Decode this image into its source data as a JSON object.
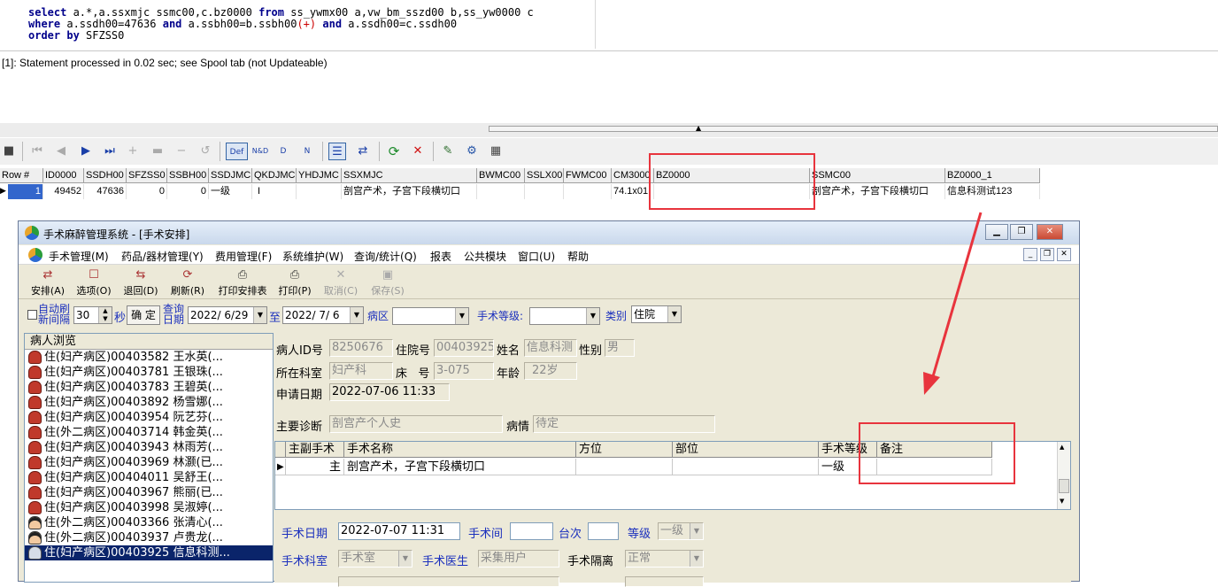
{
  "sql": {
    "line1": {
      "k1": "select",
      "t1": " a.*,a.ssxmjc ssmc00,c.bz0000 ",
      "k2": "from",
      "t2": " ss_ywmx00 a,vw_bm_sszd00 b,ss_yw0000 c"
    },
    "line2": {
      "k1": "where",
      "t1": " a.ssdh00=47636 ",
      "k2": "and",
      "t2": " a.ssbh00=b.ssbh00",
      "pl": "(+)",
      "k3": "and",
      "t3": " a.ssdh00=c.ssdh00"
    },
    "line3": {
      "k1": "order by",
      "t1": " SFZSS0"
    }
  },
  "status_message": "[1]: Statement processed in 0.02 sec; see Spool tab (not Updateable)",
  "toolbar": {
    "def_label": "Def",
    "nd_label": "N&D",
    "d_label": "D",
    "n_label": "N"
  },
  "result_grid": {
    "headers": [
      "Row #",
      "ID0000",
      "SSDH00",
      "SFZSS0",
      "SSBH00",
      "SSDJMC",
      "QKDJMC",
      "YHDJMC",
      "SSXMJC",
      "BWMC00",
      "SSLX00",
      "FWMC00",
      "CM3000",
      "BZ0000",
      "SSMC00",
      "BZ0000_1"
    ],
    "row": [
      "1",
      "49452",
      "47636",
      "0",
      "0",
      "一级",
      "I",
      "",
      "剖宫产术，子宫下段横切口",
      "",
      "",
      "",
      "74.1x01",
      "",
      "剖宫产术，子宫下段横切口",
      "信息科测试123"
    ]
  },
  "app": {
    "title": "手术麻醉管理系统 - [手术安排]",
    "menus": [
      "手术管理(M)",
      "药品/器材管理(Y)",
      "费用管理(F)",
      "系统维护(W)",
      "查询/统计(Q)",
      "报表",
      "公共模块",
      "窗口(U)",
      "帮助"
    ],
    "toolbar": [
      {
        "label": "安排(A)",
        "icon": "arrange-icon",
        "enabled": true
      },
      {
        "label": "选项(O)",
        "icon": "options-icon",
        "enabled": true
      },
      {
        "label": "退回(D)",
        "icon": "return-icon",
        "enabled": true
      },
      {
        "label": "刷新(R)",
        "icon": "refresh-icon",
        "enabled": true
      },
      {
        "label": "打印安排表",
        "icon": "print-schedule-icon",
        "enabled": true
      },
      {
        "label": "打印(P)",
        "icon": "print-icon",
        "enabled": true
      },
      {
        "label": "取消(C)",
        "icon": "cancel-icon",
        "enabled": false
      },
      {
        "label": "保存(S)",
        "icon": "save-icon",
        "enabled": false
      }
    ],
    "filter": {
      "auto_refresh_label_1": "自动刷",
      "auto_refresh_label_2": "新间隔",
      "interval_value": "30",
      "interval_unit": "秒",
      "confirm_label": "确 定",
      "query_label_1": "查询",
      "query_label_2": "日期",
      "date_from": "2022/ 6/29",
      "to_label": "至",
      "date_to": "2022/ 7/ 6",
      "ward_label": "病区",
      "ward_value": "",
      "level_label": "手术等级:",
      "level_value": "",
      "type_label": "类别",
      "type_value": "住院"
    },
    "patients": {
      "header": "病人浏览",
      "items": [
        {
          "text": "住(妇产病区)00403582 王水英(...",
          "icon": "f"
        },
        {
          "text": "住(妇产病区)00403781 王银珠(...",
          "icon": "f"
        },
        {
          "text": "住(妇产病区)00403783 王碧英(...",
          "icon": "f"
        },
        {
          "text": "住(妇产病区)00403892 杨雪娜(...",
          "icon": "f"
        },
        {
          "text": "住(妇产病区)00403954 阮艺芬(...",
          "icon": "f"
        },
        {
          "text": "住(外二病区)00403714 韩金英(...",
          "icon": "f"
        },
        {
          "text": "住(妇产病区)00403943 林雨芳(...",
          "icon": "f"
        },
        {
          "text": "住(妇产病区)00403969 林灏(已...",
          "icon": "f"
        },
        {
          "text": "住(妇产病区)00404011 吴舒王(...",
          "icon": "f"
        },
        {
          "text": "住(妇产病区)00403967 熊丽(已...",
          "icon": "f"
        },
        {
          "text": "住(妇产病区)00403998 吴淑婷(...",
          "icon": "f"
        },
        {
          "text": "住(外二病区)00403366 张清心(...",
          "icon": "m"
        },
        {
          "text": "住(外二病区)00403937 卢贵龙(...",
          "icon": "m"
        },
        {
          "text": "住(妇产病区)00403925 信息科测...",
          "icon": "s",
          "selected": true
        }
      ]
    },
    "detail": {
      "patient_id_label": "病人ID号",
      "patient_id": "8250676",
      "inpatient_no_label": "住院号",
      "inpatient_no": "00403925",
      "name_label": "姓名",
      "name": "信息科测",
      "gender_label": "性别",
      "gender": "男",
      "dept_label": "所在科室",
      "dept": "妇产科",
      "bed_label": "床   号",
      "bed": "3-075",
      "age_label": "年龄",
      "age": "22岁",
      "apply_date_label": "申请日期",
      "apply_date": "2022-07-06 11:33",
      "diagnosis_label": "主要诊断",
      "diagnosis": "剖宫产个人史",
      "condition_label": "病情",
      "condition": "待定"
    },
    "surgery_grid": {
      "headers": [
        "主副手术",
        "手术名称",
        "方位",
        "部位",
        "手术等级",
        "备注"
      ],
      "row": [
        "主",
        "剖宫产术，子宫下段横切口",
        "",
        "",
        "一级",
        ""
      ]
    },
    "schedule": {
      "date_label": "手术日期",
      "date": "2022-07-07 11:31",
      "room_label": "手术间",
      "room": "",
      "table_label": "台次",
      "table": "",
      "grade_label": "等级",
      "grade": "一级",
      "dept_label": "手术科室",
      "dept": "手术室",
      "doctor_label": "手术医生",
      "doctor": "采集用户",
      "isolation_label": "手术隔离",
      "isolation": "正常"
    }
  },
  "colors": {
    "annotation": "#e8343d",
    "selection": "#3366cc",
    "app_selection": "#0a246a"
  }
}
